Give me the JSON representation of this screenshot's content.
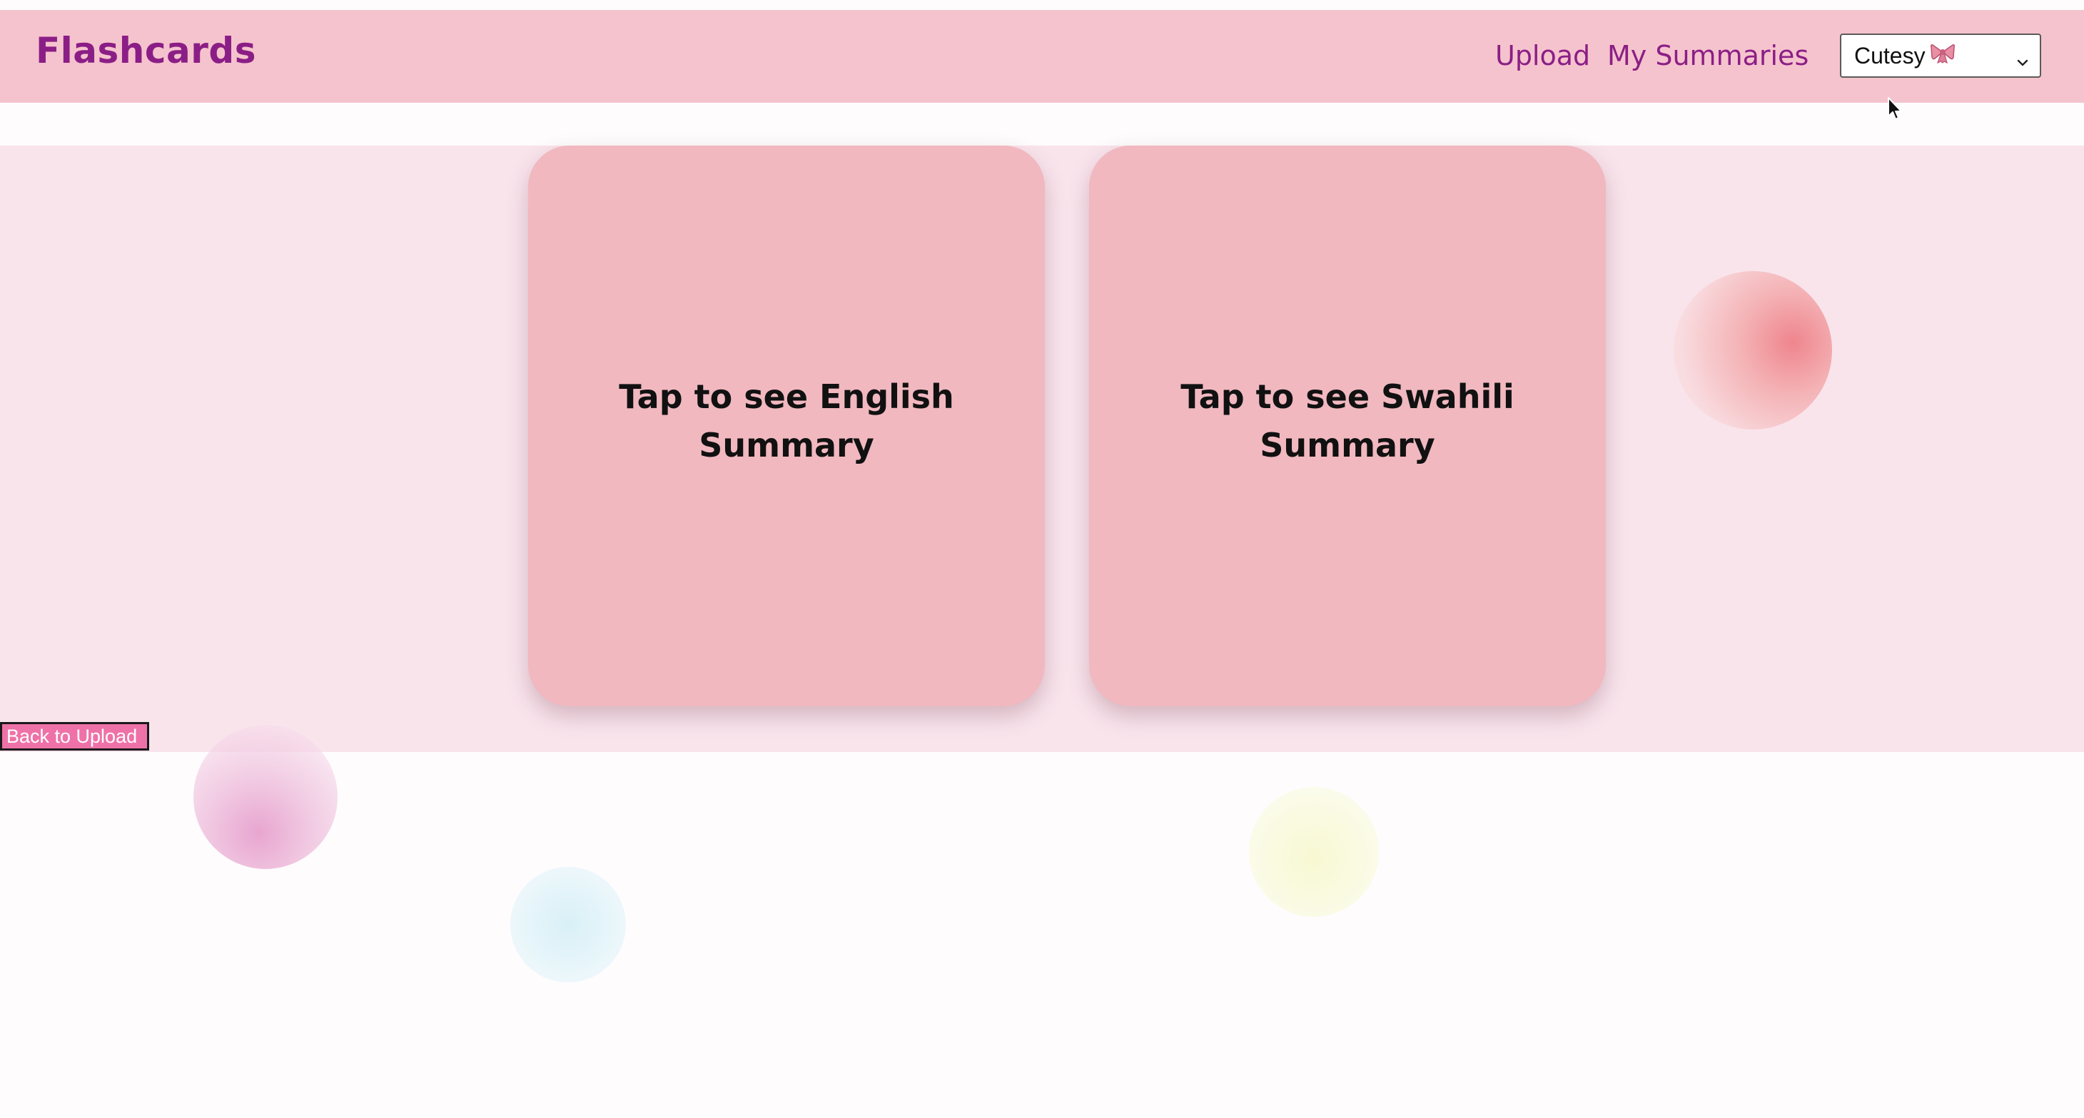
{
  "app": {
    "brand": "Flashcards"
  },
  "nav": {
    "links": [
      {
        "label": "Upload"
      },
      {
        "label": "My Summaries"
      }
    ],
    "theme_select": {
      "selected": "Cutesy",
      "icon": "ribbon-bow-icon"
    }
  },
  "cards": [
    {
      "label": "Tap to see English Summary"
    },
    {
      "label": "Tap to see Swahili Summary"
    }
  ],
  "actions": {
    "back_label": "Back to Upload"
  },
  "colors": {
    "navbar": "#f5c3cd",
    "brand_text": "#8b1e86",
    "stage": "#f9e4ec",
    "card": "#f1b8c0",
    "back_button": "#ee72a8"
  }
}
